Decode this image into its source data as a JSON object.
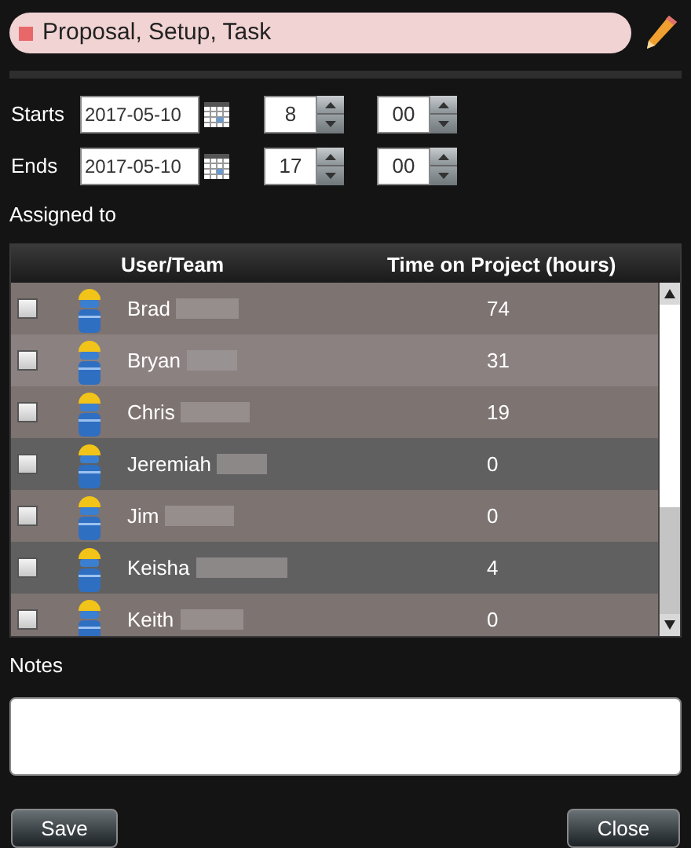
{
  "title": {
    "text": "Proposal, Setup, Task",
    "color": "#e8686a"
  },
  "schedule": [
    {
      "label": "Starts",
      "date": "2017-05-10",
      "hour": "8",
      "minute": "00"
    },
    {
      "label": "Ends",
      "date": "2017-05-10",
      "hour": "17",
      "minute": "00"
    }
  ],
  "assigned_label": "Assigned to",
  "table": {
    "columns": [
      "User/Team",
      "Time on Project (hours)"
    ],
    "rows": [
      {
        "name": "Brad",
        "hours": "74",
        "checked": false,
        "color": "#7d7371"
      },
      {
        "name": "Bryan",
        "hours": "31",
        "checked": false,
        "color": "#8b8180"
      },
      {
        "name": "Chris",
        "hours": "19",
        "checked": false,
        "color": "#7d7371"
      },
      {
        "name": "Jeremiah",
        "hours": "0",
        "checked": false,
        "color": "#606060"
      },
      {
        "name": "Jim",
        "hours": "0",
        "checked": false,
        "color": "#7d7371"
      },
      {
        "name": "Keisha",
        "hours": "4",
        "checked": false,
        "color": "#606060"
      },
      {
        "name": "Keith",
        "hours": "0",
        "checked": false,
        "color": "#7d7371"
      }
    ]
  },
  "notes": {
    "label": "Notes"
  },
  "buttons": {
    "save": "Save",
    "close": "Close"
  }
}
